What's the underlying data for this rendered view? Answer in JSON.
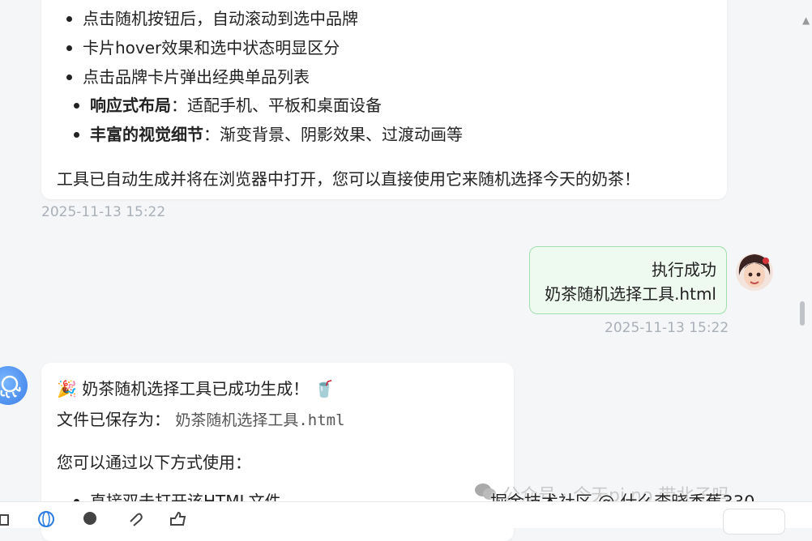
{
  "prev_message": {
    "sub_bullets": [
      "点击随机按钮后，自动滚动到选中品牌",
      "卡片hover效果和选中状态明显区分",
      "点击品牌卡片弹出经典单品列表"
    ],
    "bullets": [
      {
        "bold": "响应式布局",
        "text": "：适配手机、平板和桌面设备"
      },
      {
        "bold": "丰富的视觉细节",
        "text": "：渐变背景、阴影效果、过渡动画等"
      }
    ],
    "closing": "工具已自动生成并将在浏览器中打开，您可以直接使用它来随机选择今天的奶茶！",
    "timestamp": "2025-11-13 15:22"
  },
  "user_message": {
    "line1": "执行成功",
    "line2": "奶茶随机选择工具.html",
    "timestamp": "2025-11-13 15:22"
  },
  "bot_message": {
    "title_emoji": "🎉",
    "title": "奶茶随机选择工具已成功生成！",
    "title_emoji_end": "🥤",
    "saved_label": "文件已保存为：",
    "saved_file": "奶茶随机选择工具.html",
    "usage_intro": "您可以通过以下方式使用：",
    "first_item": "直接双击打开该HTML文件"
  },
  "watermark": {
    "ghost": "公众号 · 今天pi no 带北子吗",
    "text": "掘金技术社区 @ 什么李晓香蕉330"
  },
  "toolbar": {
    "icons": [
      "pen-icon",
      "globe-icon",
      "circle-icon",
      "attach-icon",
      "thumb-icon"
    ]
  },
  "colors": {
    "user_bubble_bg": "#eefaf0",
    "user_bubble_border": "#9fdfae",
    "timestamp": "#aab0b8",
    "page_bg": "#f5f6f8"
  }
}
